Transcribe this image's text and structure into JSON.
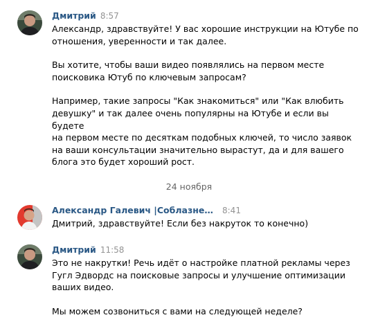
{
  "messages": [
    {
      "author": "Дмитрий",
      "time": "8:57",
      "paragraphs": [
        "Александр, здравствуйте! У вас хорошие инструкции на Ютубе по\nотношения, уверенности и так далее.",
        "Вы хотите, чтобы ваши видео появлялись на первом месте\nпоисковика Ютуб по ключевым запросам?",
        "Например, такие запросы \"Как знакомиться\" или \"Как влюбить\nдевушку\" и так далее очень популярны на Ютубе и если вы будете\nна первом месте по десяткам подобных ключей, то число заявок\nна ваши консультации значительно вырастут, да и для вашего\nблога это будет хороший рост."
      ]
    },
    {
      "author": "Александр Галевич |Соблазнение и ли...",
      "time": "8:41",
      "paragraphs": [
        "Дмитрий, здравствуйте! Если без накруток то конечно)"
      ]
    },
    {
      "author": "Дмитрий",
      "time": "11:58",
      "paragraphs": [
        "Это не накрутки! Речь идёт о настройке платной рекламы через\nГугл Эдвордс на поисковые запросы и улучшение оптимизации\nваших видео.",
        "Мы можем созвониться с вами на следующей неделе?"
      ]
    }
  ],
  "date_separator": "24 ноября",
  "colors": {
    "author": "#2a5885",
    "time": "#939393",
    "separator": "#656565"
  }
}
